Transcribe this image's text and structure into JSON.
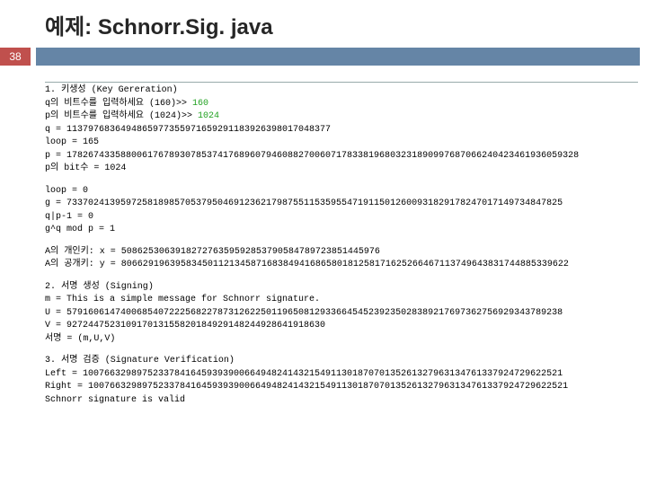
{
  "title": "예제: Schnorr.Sig. java",
  "page_number": "38",
  "output": {
    "section1_header": "1. 키생성 (Key Gereration)",
    "q_prompt": "q의 비트수를 입력하세요 (160)>> ",
    "q_input": "160",
    "p_prompt": "p의 비트수를 입력하세요 (1024)>> ",
    "p_input": "1024",
    "q_line": "q = 1137976836494865977355971659291183926398017048377",
    "loop1_line": "loop = 165",
    "p_line": "p = 17826743358800617678930785374176896079460882700607178338196803231890997687066240423461936059328",
    "pbit_line": "p의 bit수 = 1024",
    "loop2_line": "loop = 0",
    "g_line": "g = 73370241395972581898570537950469123621798755115359554719115012600931829178247017149734847825",
    "q_div_line": "q|p-1 = 0",
    "gqmod_line": "g^q mod p = 1",
    "x_line": "A의 개인키: x = 508625306391827276359592853790584789723851445976",
    "y_line": "A의 공개키: y = 80662919639583450112134587168384941686580181258171625266467113749643831744885339622",
    "section2_header": "2. 서명 생성 (Signing)",
    "m_line": "m = This is a simple message for Schnorr signature.",
    "u_line": "U = 57916061474006854072225682278731262250119650812933664545239235028389217697362756929343789238",
    "v_line": "V = 927244752310917013155820184929148244928641918630",
    "sig_line": "서명 = (m,U,V)",
    "section3_header": "3. 서명 검증 (Signature Verification)",
    "left_line": "Left  = 10076632989752337841645939390066494824143215491130187070135261327963134761337924729622521",
    "right_line": "Right = 10076632989752337841645939390066494824143215491130187070135261327963134761337924729622521",
    "valid_line": "Schnorr signature is valid"
  }
}
